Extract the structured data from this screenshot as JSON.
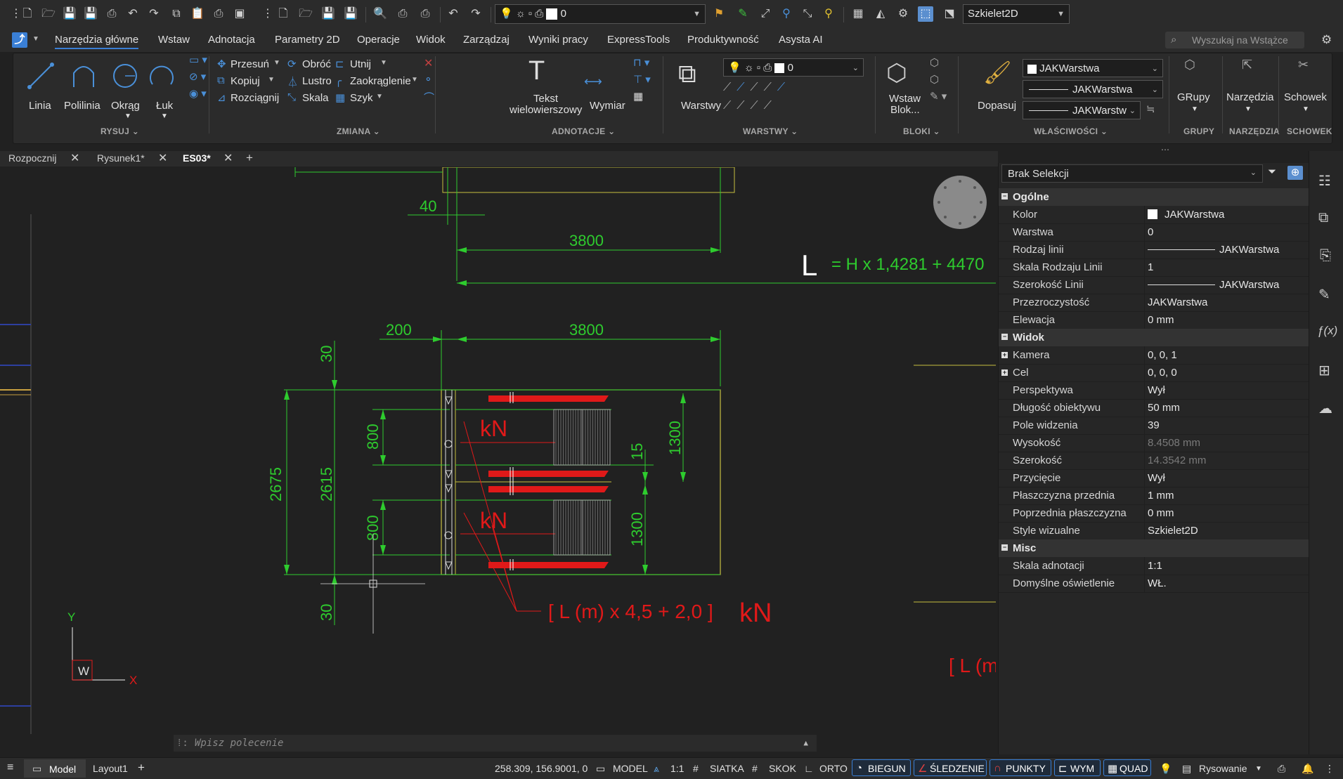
{
  "toolbar": {
    "layer_value": "0",
    "visual_style": "Szkielet2D"
  },
  "ribbon_tabs": [
    "Narzędzia główne",
    "Wstaw",
    "Adnotacja",
    "Parametry 2D",
    "Operacje",
    "Widok",
    "Zarządzaj",
    "Wyniki pracy",
    "ExpressTools",
    "Produktywność",
    "Asysta AI"
  ],
  "search_placeholder": "Wyszukaj na Wstążce",
  "ribbon": {
    "draw": {
      "linia": "Linia",
      "polilinia": "Polilinia",
      "okrag": "Okrąg",
      "luk": "Łuk",
      "section": "RYSUJ"
    },
    "modify": {
      "przesun": "Przesuń",
      "obroc": "Obróć",
      "utnij": "Utnij",
      "kopiuj": "Kopiuj",
      "lustro": "Lustro",
      "zaokraglenie": "Zaokrąglenie",
      "rozciagnij": "Rozciągnij",
      "skala": "Skala",
      "szyk": "Szyk",
      "section": "ZMIANA"
    },
    "annot": {
      "tekst1": "Tekst",
      "tekst2": "wielowierszowy",
      "wymiar": "Wymiar",
      "section": "ADNOTACJE"
    },
    "layers": {
      "warstwy": "Warstwy",
      "layer_value": "0",
      "section": "WARSTWY"
    },
    "blocks": {
      "wstaw1": "Wstaw",
      "wstaw2": "Blok...",
      "section": "BLOKI"
    },
    "props": {
      "dopasuj": "Dopasuj",
      "color": "JAKWarstwa",
      "linetype": "JAKWarstwa",
      "lineweight": "JAKWarstw",
      "section": "WŁAŚCIWOŚCI"
    },
    "groups": {
      "label": "GRupy",
      "section": "GRUPY"
    },
    "tools": {
      "label": "Narzędzia",
      "section": "NARZĘDZIA"
    },
    "clipboard": {
      "label": "Schowek",
      "section": "SCHOWEK"
    }
  },
  "doc_tabs": [
    "Rozpocznij",
    "Rysunek1*",
    "ES03*"
  ],
  "drawing": {
    "dim_40": "40",
    "dim_3800a": "3800",
    "formula_L": "L",
    "formula": "= H x 1,4281 + 4470",
    "dim_200": "200",
    "dim_3800b": "3800",
    "dim_30a": "30",
    "dim_2675": "2675",
    "dim_2615": "2615",
    "dim_800a": "800",
    "dim_800b": "800",
    "dim_15": "15",
    "dim_1300a": "1300",
    "dim_1300b": "1300",
    "kN1": "kN",
    "kN2": "kN",
    "dim_30b": "30",
    "load_formula": "[ L (m) x 4,5  + 2,0 ]",
    "load_unit": "kN",
    "load_cut": "[ L (m",
    "ucs_y": "Y",
    "ucs_x": "X",
    "ucs_w": "W"
  },
  "command_placeholder": "Wpisz polecenie",
  "properties": {
    "selection": "Brak Selekcji",
    "sections": [
      {
        "title": "Ogólne",
        "rows": [
          {
            "name": "Kolor",
            "value": "JAKWarstwa"
          },
          {
            "name": "Warstwa",
            "value": "0"
          },
          {
            "name": "Rodzaj linii",
            "value": "JAKWarstwa"
          },
          {
            "name": "Skala Rodzaju Linii",
            "value": "1"
          },
          {
            "name": "Szerokość Linii",
            "value": "JAKWarstwa"
          },
          {
            "name": "Przezroczystość",
            "value": "JAKWarstwa"
          },
          {
            "name": "Elewacja",
            "value": "0 mm"
          }
        ]
      },
      {
        "title": "Widok",
        "rows": [
          {
            "name": "Kamera",
            "value": "0, 0, 1"
          },
          {
            "name": "Cel",
            "value": "0, 0, 0"
          },
          {
            "name": "Perspektywa",
            "value": "Wył"
          },
          {
            "name": "Długość obiektywu",
            "value": "50 mm"
          },
          {
            "name": "Pole widzenia",
            "value": "39"
          },
          {
            "name": "Wysokość",
            "value": "8.4508 mm"
          },
          {
            "name": "Szerokość",
            "value": "14.3542 mm"
          },
          {
            "name": "Przycięcie",
            "value": "Wył"
          },
          {
            "name": "Płaszczyzna przednia",
            "value": "1 mm"
          },
          {
            "name": "Poprzednia płaszczyzna",
            "value": "0 mm"
          },
          {
            "name": "Style wizualne",
            "value": "Szkielet2D"
          }
        ]
      },
      {
        "title": "Misc",
        "rows": [
          {
            "name": "Skala adnotacji",
            "value": "1:1"
          },
          {
            "name": "Domyślne oświetlenie",
            "value": "WŁ."
          }
        ]
      }
    ]
  },
  "status": {
    "model_tab": "Model",
    "layout_tab": "Layout1",
    "coords": "258.309, 156.9001, 0",
    "model": "MODEL",
    "scale": "1:1",
    "siatka": "SIATKA",
    "skok": "SKOK",
    "orto": "ORTO",
    "biegun": "BIEGUN",
    "sledzenie": "ŚLEDZENIE",
    "punkty": "PUNKTY",
    "wym": "WYM",
    "quad": "QUAD",
    "workspace": "Rysowanie"
  }
}
